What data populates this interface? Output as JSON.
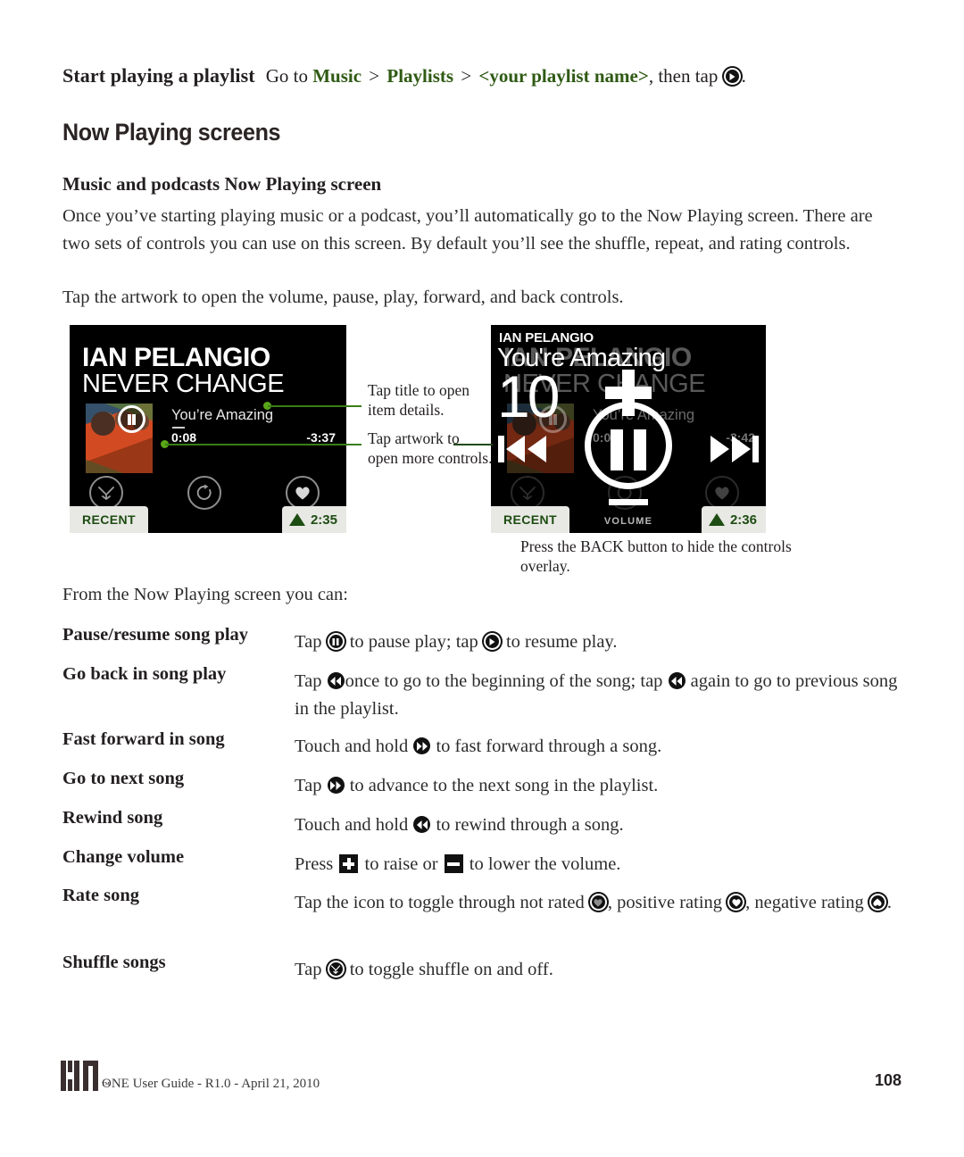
{
  "top_entry": {
    "term": "Start playing a playlist",
    "desc_prefix": "Go to ",
    "nav": [
      "Music",
      "Playlists",
      "<your playlist name>"
    ],
    "desc_suffix": ", then tap ",
    "desc_end": ".",
    "play_icon": "play-circle-icon"
  },
  "headings": {
    "h1": "Now Playing screens",
    "h2": "Music and podcasts Now Playing screen"
  },
  "paragraphs": {
    "intro": "Once you’ve starting playing music or a podcast, you’ll automatically go to the Now Playing screen. There are two sets of controls you can use on this screen. By default you’ll see the shuffle, repeat, and rating controls.",
    "tap_artwork": "Tap the artwork to open the volume, pause, play, forward, and back controls.",
    "from_screen": "From the Now Playing screen you can:"
  },
  "phone_left": {
    "artist": "IAN PELANGIO",
    "album": "NEVER CHANGE",
    "song": "You’re Amazing",
    "time_current": "0:08",
    "time_remaining": "-3:37",
    "buttons": [
      "shuffle-icon",
      "repeat-icon",
      "heart-icon"
    ],
    "status_recent": "RECENT",
    "status_clock": "2:35"
  },
  "phone_right": {
    "overlay_artist": "IAN PELANGIO",
    "overlay_song": "You're Amazing",
    "volume_level": "10",
    "artist": "IAN PELANGIO",
    "album": "NEVER CHANGE",
    "song": "You’re Amazing",
    "time_current": "0:08",
    "time_remaining": "-3:42",
    "volume_label": "VOLUME",
    "status_recent": "RECENT",
    "status_clock": "2:36",
    "controls": [
      "previous-icon",
      "pause-icon",
      "next-icon",
      "volume-up-icon",
      "volume-down-icon"
    ]
  },
  "callouts": {
    "title": "Tap title to open item details.",
    "artwork": "Tap artwork to open more controls.",
    "caption": "Press the BACK button to hide the controls overlay."
  },
  "definitions": [
    {
      "term": "Pause/resume song play",
      "parts": [
        {
          "t": "text",
          "v": "Tap "
        },
        {
          "t": "icon",
          "v": "pause-circle-icon"
        },
        {
          "t": "text",
          "v": " to pause play; tap "
        },
        {
          "t": "icon",
          "v": "play-circle-icon"
        },
        {
          "t": "text",
          "v": " to resume play."
        }
      ]
    },
    {
      "term": "Go back in song play",
      "parts": [
        {
          "t": "text",
          "v": "Tap "
        },
        {
          "t": "icon",
          "v": "rewind-icon"
        },
        {
          "t": "text",
          "v": "once to go to the beginning of the song; tap "
        },
        {
          "t": "icon",
          "v": "rewind-icon"
        },
        {
          "t": "text",
          "v": " again to go to previous song in the playlist."
        }
      ]
    },
    {
      "term": "Fast forward in song",
      "parts": [
        {
          "t": "text",
          "v": "Touch and hold "
        },
        {
          "t": "icon",
          "v": "fast-forward-icon"
        },
        {
          "t": "text",
          "v": " to fast forward through a song."
        }
      ]
    },
    {
      "term": "Go to next song",
      "parts": [
        {
          "t": "text",
          "v": "Tap "
        },
        {
          "t": "icon",
          "v": "fast-forward-icon"
        },
        {
          "t": "text",
          "v": " to advance to the next song in the playlist."
        }
      ]
    },
    {
      "term": "Rewind song",
      "parts": [
        {
          "t": "text",
          "v": "Touch and hold "
        },
        {
          "t": "icon",
          "v": "rewind-icon"
        },
        {
          "t": "text",
          "v": " to rewind through a song."
        }
      ]
    },
    {
      "term": "Change volume",
      "parts": [
        {
          "t": "text",
          "v": "Press "
        },
        {
          "t": "icon",
          "v": "volume-up-icon"
        },
        {
          "t": "text",
          "v": " to raise or "
        },
        {
          "t": "icon",
          "v": "volume-down-icon"
        },
        {
          "t": "text",
          "v": " to lower the volume."
        }
      ]
    },
    {
      "term": "Rate song",
      "parts": [
        {
          "t": "text",
          "v": "Tap the icon to toggle through not rated "
        },
        {
          "t": "icon",
          "v": "rating-none-icon"
        },
        {
          "t": "text",
          "v": ", positive rating "
        },
        {
          "t": "icon",
          "v": "rating-positive-icon"
        },
        {
          "t": "text",
          "v": ", negative rating "
        },
        {
          "t": "icon",
          "v": "rating-negative-icon"
        },
        {
          "t": "text",
          "v": "."
        }
      ]
    },
    {
      "term": "Shuffle songs",
      "parts": [
        {
          "t": "text",
          "v": "Tap "
        },
        {
          "t": "icon",
          "v": "shuffle-icon"
        },
        {
          "t": "text",
          "v": " to toggle shuffle on and off."
        }
      ]
    }
  ],
  "footer": {
    "logo": "KIN",
    "tm": "™",
    "text": "ONE User Guide - R1.0 - April 21, 2010",
    "page": "108"
  },
  "colors": {
    "nav_green": "#2f5a14",
    "leader_green": "#3b7d16",
    "status_green": "#1d4d12",
    "ink": "#231f20"
  }
}
